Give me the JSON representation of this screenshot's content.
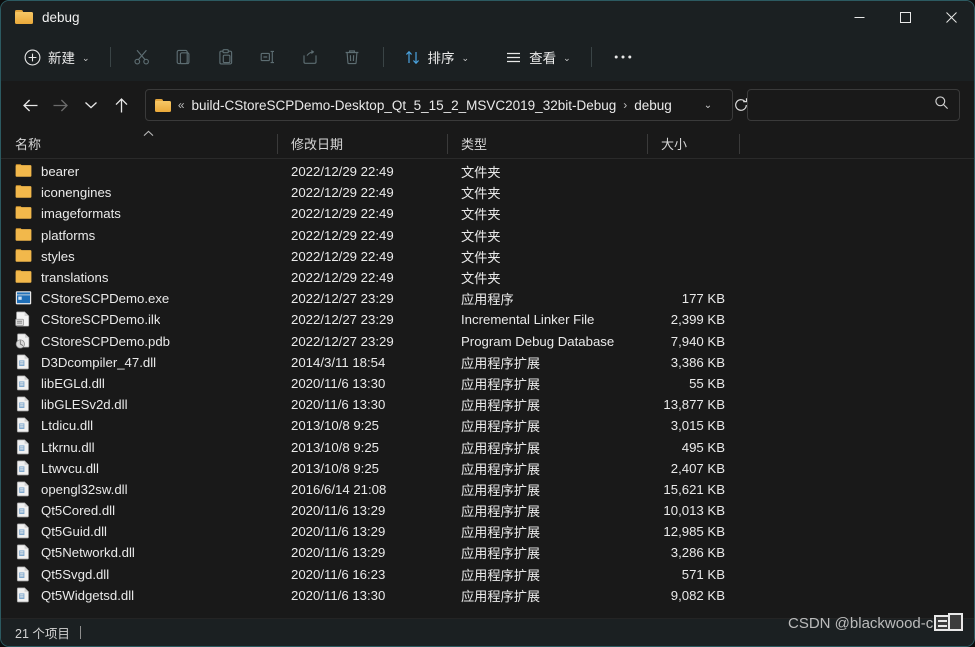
{
  "window": {
    "title": "debug",
    "title_icon": "folder-icon",
    "controls": {
      "minimize": "minimize-icon",
      "maximize": "maximize-icon",
      "close": "close-icon"
    }
  },
  "commandbar": {
    "new_label": "新建",
    "new_icon": "plus-circle-icon",
    "cut_icon": "scissors-icon",
    "copy_icon": "copy-icon",
    "paste_icon": "paste-icon",
    "rename_icon": "rename-icon",
    "share_icon": "share-icon",
    "delete_icon": "trash-icon",
    "sort_label": "排序",
    "sort_icon": "sort-arrows-icon",
    "view_label": "查看",
    "view_icon": "list-lines-icon",
    "more_label": "···",
    "chevron": "⌄"
  },
  "address": {
    "back_icon": "arrow-left-icon",
    "forward_icon": "arrow-right-icon",
    "recent_icon": "chevron-down-icon",
    "up_icon": "arrow-up-icon",
    "path_icon": "folder-icon",
    "overflow": "«",
    "crumb1": "build-CStoreSCPDemo-Desktop_Qt_5_15_2_MSVC2019_32bit-Debug",
    "crumb_sep": "›",
    "crumb2": "debug",
    "dropdown_chevron": "⌄",
    "refresh_icon": "refresh-icon",
    "search_value": "",
    "search_placeholder": "",
    "search_icon": "search-icon"
  },
  "columns": {
    "name": "名称",
    "date": "修改日期",
    "type": "类型",
    "size": "大小",
    "sort_indicator": "︿"
  },
  "files": [
    {
      "icon": "folder-icon",
      "name": "bearer",
      "date": "2022/12/29 22:49",
      "type": "文件夹",
      "size": ""
    },
    {
      "icon": "folder-icon",
      "name": "iconengines",
      "date": "2022/12/29 22:49",
      "type": "文件夹",
      "size": ""
    },
    {
      "icon": "folder-icon",
      "name": "imageformats",
      "date": "2022/12/29 22:49",
      "type": "文件夹",
      "size": ""
    },
    {
      "icon": "folder-icon",
      "name": "platforms",
      "date": "2022/12/29 22:49",
      "type": "文件夹",
      "size": ""
    },
    {
      "icon": "folder-icon",
      "name": "styles",
      "date": "2022/12/29 22:49",
      "type": "文件夹",
      "size": ""
    },
    {
      "icon": "folder-icon",
      "name": "translations",
      "date": "2022/12/29 22:49",
      "type": "文件夹",
      "size": ""
    },
    {
      "icon": "exe-icon",
      "name": "CStoreSCPDemo.exe",
      "date": "2022/12/27 23:29",
      "type": "应用程序",
      "size": "177 KB"
    },
    {
      "icon": "ilk-icon",
      "name": "CStoreSCPDemo.ilk",
      "date": "2022/12/27 23:29",
      "type": "Incremental Linker File",
      "size": "2,399 KB"
    },
    {
      "icon": "pdb-icon",
      "name": "CStoreSCPDemo.pdb",
      "date": "2022/12/27 23:29",
      "type": "Program Debug Database",
      "size": "7,940 KB"
    },
    {
      "icon": "dll-icon",
      "name": "D3Dcompiler_47.dll",
      "date": "2014/3/11 18:54",
      "type": "应用程序扩展",
      "size": "3,386 KB"
    },
    {
      "icon": "dll-icon",
      "name": "libEGLd.dll",
      "date": "2020/11/6 13:30",
      "type": "应用程序扩展",
      "size": "55 KB"
    },
    {
      "icon": "dll-icon",
      "name": "libGLESv2d.dll",
      "date": "2020/11/6 13:30",
      "type": "应用程序扩展",
      "size": "13,877 KB"
    },
    {
      "icon": "dll-icon",
      "name": "Ltdicu.dll",
      "date": "2013/10/8 9:25",
      "type": "应用程序扩展",
      "size": "3,015 KB"
    },
    {
      "icon": "dll-icon",
      "name": "Ltkrnu.dll",
      "date": "2013/10/8 9:25",
      "type": "应用程序扩展",
      "size": "495 KB"
    },
    {
      "icon": "dll-icon",
      "name": "Ltwvcu.dll",
      "date": "2013/10/8 9:25",
      "type": "应用程序扩展",
      "size": "2,407 KB"
    },
    {
      "icon": "dll-icon",
      "name": "opengl32sw.dll",
      "date": "2016/6/14 21:08",
      "type": "应用程序扩展",
      "size": "15,621 KB"
    },
    {
      "icon": "dll-icon",
      "name": "Qt5Cored.dll",
      "date": "2020/11/6 13:29",
      "type": "应用程序扩展",
      "size": "10,013 KB"
    },
    {
      "icon": "dll-icon",
      "name": "Qt5Guid.dll",
      "date": "2020/11/6 13:29",
      "type": "应用程序扩展",
      "size": "12,985 KB"
    },
    {
      "icon": "dll-icon",
      "name": "Qt5Networkd.dll",
      "date": "2020/11/6 13:29",
      "type": "应用程序扩展",
      "size": "3,286 KB"
    },
    {
      "icon": "dll-icon",
      "name": "Qt5Svgd.dll",
      "date": "2020/11/6 16:23",
      "type": "应用程序扩展",
      "size": "571 KB"
    },
    {
      "icon": "dll-icon",
      "name": "Qt5Widgetsd.dll",
      "date": "2020/11/6 13:30",
      "type": "应用程序扩展",
      "size": "9,082 KB"
    }
  ],
  "statusbar": {
    "item_count": "21 个项目"
  },
  "watermark": {
    "text": "CSDN @blackwood-cliff",
    "badge_icon": "window-stack-icon"
  },
  "colors": {
    "window_border": "#2c5a61",
    "chrome": "#1b2022",
    "content": "#191919",
    "text": "#eaeaea",
    "disabled": "#5d6d72",
    "accent_blue": "#4aa3df",
    "folder_gold": "#eaa93a"
  }
}
